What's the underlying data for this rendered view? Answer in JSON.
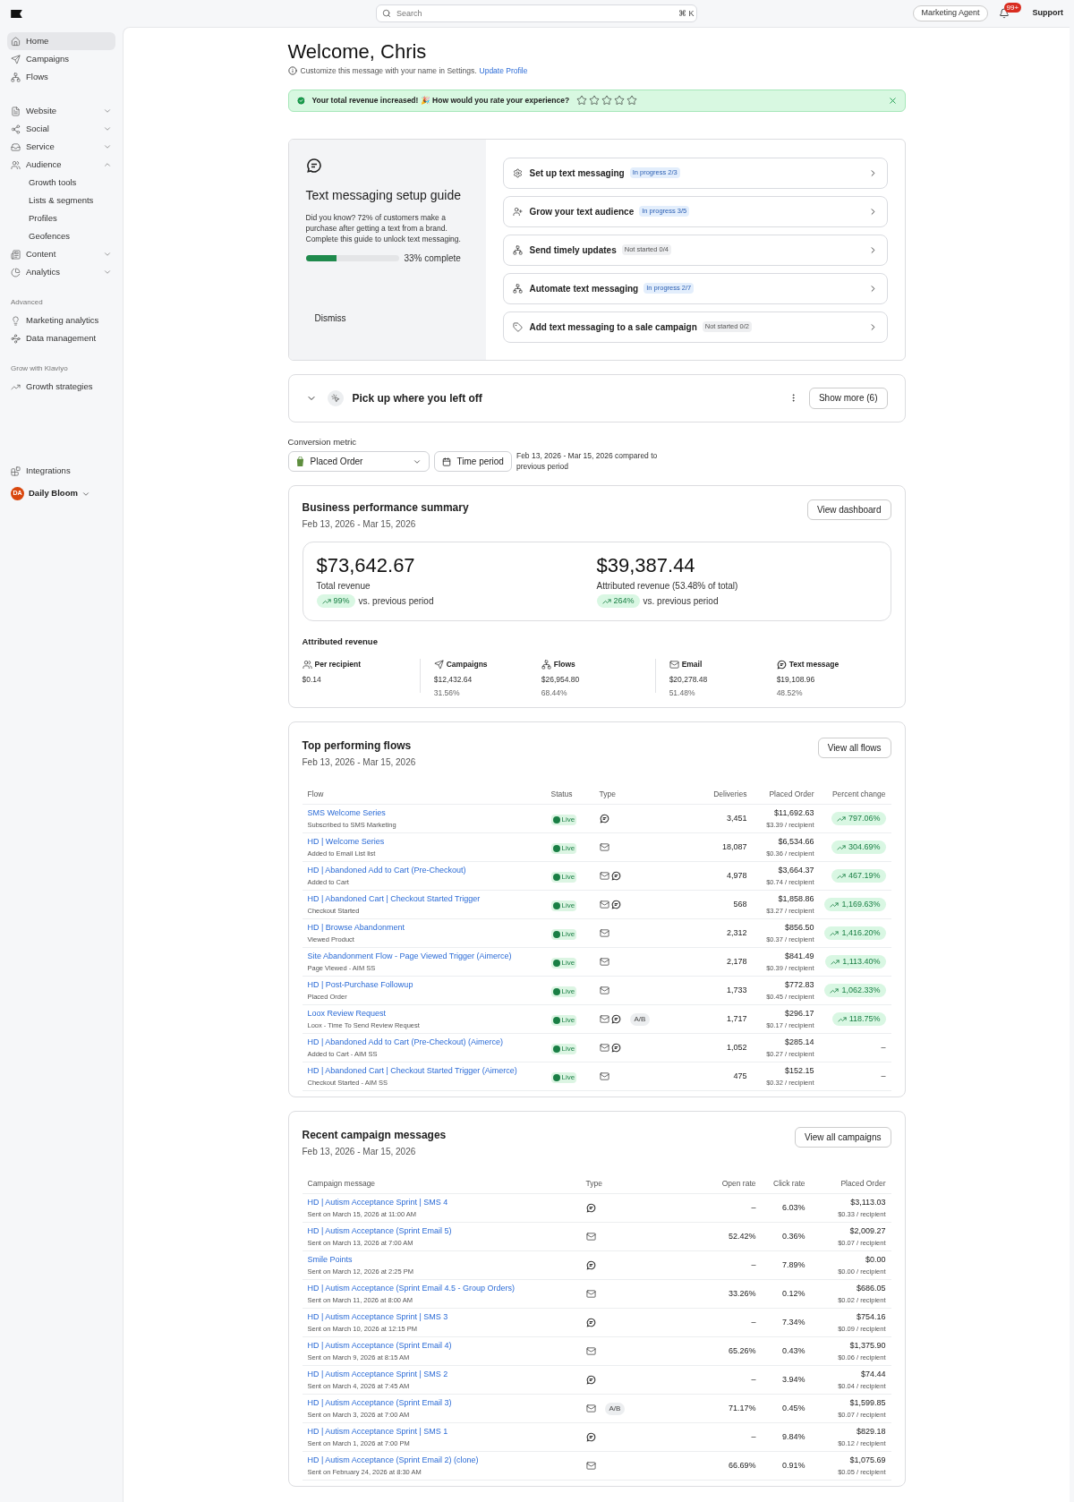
{
  "header": {
    "search": {
      "placeholder": "Search",
      "shortcut": "⌘ K"
    },
    "agent_button": "Marketing Agent",
    "notifications": "99+",
    "support": "Support"
  },
  "sidebar": {
    "groups": [
      {
        "items": [
          {
            "label": "Home",
            "selected": true
          },
          {
            "label": "Campaigns",
            "selected": false
          },
          {
            "label": "Flows",
            "selected": false
          }
        ]
      },
      {
        "items": [
          {
            "label": "Website",
            "selected": false,
            "expanded": false
          },
          {
            "label": "Social",
            "selected": false,
            "expanded": false
          },
          {
            "label": "Service",
            "selected": false,
            "expanded": false
          },
          {
            "label": "Audience",
            "selected": false,
            "expanded": true,
            "children": [
              {
                "label": "Growth tools",
                "selected": false
              },
              {
                "label": "Lists & segments",
                "selected": false
              },
              {
                "label": "Profiles",
                "selected": false
              },
              {
                "label": "Geofences",
                "selected": false
              }
            ]
          },
          {
            "label": "Content",
            "selected": false,
            "expanded": false
          },
          {
            "label": "Analytics",
            "selected": false,
            "expanded": false
          }
        ]
      },
      {
        "heading": "Advanced",
        "items": [
          {
            "label": "Marketing analytics",
            "selected": false
          },
          {
            "label": "Data management",
            "selected": false
          }
        ]
      },
      {
        "heading": "Grow with Klaviyo",
        "items": [
          {
            "label": "Growth strategies",
            "selected": false
          }
        ]
      }
    ],
    "footer_items": [
      {
        "label": "Integrations",
        "selected": false
      }
    ],
    "account": {
      "initials": "DA",
      "name": "Daily Bloom"
    }
  },
  "welcome": {
    "title": "Welcome, Chris",
    "hint": "Customize this message with your name in Settings.",
    "link": "Update Profile"
  },
  "banner": {
    "text": "Your total revenue increased! 🎉 How would you rate your experience?",
    "stars": 0
  },
  "setup_guide": {
    "title": "Text messaging setup guide",
    "description": "Did you know? 72% of customers make a purchase after getting a text from a brand. Complete this guide to unlock text messaging.",
    "level": 0.33,
    "progress_text": "33% complete",
    "dismiss": "Dismiss",
    "steps": [
      {
        "label": "Set up text messaging",
        "status": "In progress 2/3",
        "kind": "in_progress"
      },
      {
        "label": "Grow your text audience",
        "status": "In progress 3/5",
        "kind": "in_progress"
      },
      {
        "label": "Send timely updates",
        "status": "Not started 0/4",
        "kind": "not_started"
      },
      {
        "label": "Automate text messaging",
        "status": "In progress 2/7",
        "kind": "in_progress"
      },
      {
        "label": "Add text messaging to a sale campaign",
        "status": "Not started 0/2",
        "kind": "not_started"
      }
    ]
  },
  "pickup": {
    "title": "Pick up where you left off",
    "expanded": false,
    "button": "Show more (6)"
  },
  "conversion": {
    "label": "Conversion metric",
    "metric": "Placed Order",
    "time_button": "Time period",
    "range": "Feb 13, 2026 - Mar 15, 2026 compared to previous period"
  },
  "summary": {
    "title": "Business performance summary",
    "dates": "Feb 13, 2026 - Mar 15, 2026",
    "button": "View dashboard",
    "stats": [
      {
        "value": "$73,642.67",
        "label": "Total revenue",
        "change": "99%",
        "suffix": "vs. previous period"
      },
      {
        "value": "$39,387.44",
        "label": "Attributed revenue (53.48% of total)",
        "change": "264%",
        "suffix": "vs. previous period"
      }
    ],
    "attributed_title": "Attributed revenue",
    "groups": [
      [
        {
          "label": "Per recipient",
          "value": "$0.14"
        }
      ],
      [
        {
          "label": "Campaigns",
          "value": "$12,432.64",
          "share": "31.56%"
        },
        {
          "label": "Flows",
          "value": "$26,954.80",
          "share": "68.44%"
        }
      ],
      [
        {
          "label": "Email",
          "value": "$20,278.48",
          "share": "51.48%"
        },
        {
          "label": "Text message",
          "value": "$19,108.96",
          "share": "48.52%"
        }
      ]
    ]
  },
  "flows": {
    "title": "Top performing flows",
    "dates": "Feb 13, 2026 - Mar 15, 2026",
    "button": "View all flows",
    "columns": [
      "Flow",
      "Status",
      "Type",
      "Deliveries",
      "Placed Order",
      "Percent change"
    ],
    "rows": [
      {
        "name": "SMS Welcome Series",
        "trigger": "Subscribed to SMS Marketing",
        "status": "Live",
        "types": [
          {
            "kind": "sms"
          }
        ],
        "deliveries": "3,451",
        "placed_order": "$11,692.63",
        "per_recipient": "$3.39 / recipient",
        "change": "797.06%",
        "trending": true
      },
      {
        "name": "HD | Welcome Series",
        "trigger": "Added to Email List list",
        "status": "Live",
        "types": [
          {
            "kind": "email"
          }
        ],
        "deliveries": "18,087",
        "placed_order": "$6,534.66",
        "per_recipient": "$0.36 / recipient",
        "change": "304.69%",
        "trending": true
      },
      {
        "name": "HD | Abandoned Add to Cart (Pre-Checkout)",
        "trigger": "Added to Cart",
        "status": "Live",
        "types": [
          {
            "kind": "email"
          },
          {
            "kind": "sms"
          }
        ],
        "deliveries": "4,978",
        "placed_order": "$3,664.37",
        "per_recipient": "$0.74 / recipient",
        "change": "467.19%",
        "trending": true
      },
      {
        "name": "HD | Abandoned Cart | Checkout Started Trigger",
        "trigger": "Checkout Started",
        "status": "Live",
        "types": [
          {
            "kind": "email"
          },
          {
            "kind": "sms"
          }
        ],
        "deliveries": "568",
        "placed_order": "$1,858.86",
        "per_recipient": "$3.27 / recipient",
        "change": "1,169.63%",
        "trending": true
      },
      {
        "name": "HD | Browse Abandonment",
        "trigger": "Viewed Product",
        "status": "Live",
        "types": [
          {
            "kind": "email"
          }
        ],
        "deliveries": "2,312",
        "placed_order": "$856.50",
        "per_recipient": "$0.37 / recipient",
        "change": "1,416.20%",
        "trending": true
      },
      {
        "name": "Site Abandonment Flow - Page Viewed Trigger (Aimerce)",
        "trigger": "Page Viewed - AIM SS",
        "status": "Live",
        "types": [
          {
            "kind": "email"
          }
        ],
        "deliveries": "2,178",
        "placed_order": "$841.49",
        "per_recipient": "$0.39 / recipient",
        "change": "1,113.40%",
        "trending": true
      },
      {
        "name": "HD | Post-Purchase Followup",
        "trigger": "Placed Order",
        "status": "Live",
        "types": [
          {
            "kind": "email"
          }
        ],
        "deliveries": "1,733",
        "placed_order": "$772.83",
        "per_recipient": "$0.45 / recipient",
        "change": "1,062.33%",
        "trending": true
      },
      {
        "name": "Loox Review Request",
        "trigger": "Loox - Time To Send Review Request",
        "status": "Live",
        "types": [
          {
            "kind": "email"
          },
          {
            "kind": "sms"
          }
        ],
        "ab": "A/B",
        "deliveries": "1,717",
        "placed_order": "$296.17",
        "per_recipient": "$0.17 / recipient",
        "change": "118.75%",
        "trending": true
      },
      {
        "name": "HD | Abandoned Add to Cart (Pre-Checkout) (Aimerce)",
        "trigger": "Added to Cart - AIM SS",
        "status": "Live",
        "types": [
          {
            "kind": "email"
          },
          {
            "kind": "sms"
          }
        ],
        "deliveries": "1,052",
        "placed_order": "$285.14",
        "per_recipient": "$0.27 / recipient",
        "change": "–",
        "trending": false
      },
      {
        "name": "HD | Abandoned Cart | Checkout Started Trigger (Aimerce)",
        "trigger": "Checkout Started - AIM SS",
        "status": "Live",
        "types": [
          {
            "kind": "email"
          }
        ],
        "deliveries": "475",
        "placed_order": "$152.15",
        "per_recipient": "$0.32 / recipient",
        "change": "–",
        "trending": false
      }
    ]
  },
  "campaigns": {
    "title": "Recent campaign messages",
    "dates": "Feb 13, 2026 - Mar 15, 2026",
    "button": "View all campaigns",
    "columns": [
      "Campaign message",
      "Type",
      "Open rate",
      "Click rate",
      "Placed Order"
    ],
    "rows": [
      {
        "name": "HD | Autism Acceptance Sprint | SMS 4",
        "sent": "Sent on March 15, 2026 at 11:00 AM",
        "kind": "sms",
        "open_rate": "–",
        "click_rate": "6.03%",
        "placed_order": "$3,113.03",
        "per_recipient": "$0.33 / recipient"
      },
      {
        "name": "HD | Autism Acceptance (Sprint Email 5)",
        "sent": "Sent on March 13, 2026 at 7:00 AM",
        "kind": "email",
        "open_rate": "52.42%",
        "click_rate": "0.36%",
        "placed_order": "$2,009.27",
        "per_recipient": "$0.07 / recipient"
      },
      {
        "name": "Smile Points",
        "sent": "Sent on March 12, 2026 at 2:25 PM",
        "kind": "sms",
        "open_rate": "–",
        "click_rate": "7.89%",
        "placed_order": "$0.00",
        "per_recipient": "$0.00 / recipient"
      },
      {
        "name": "HD | Autism Acceptance (Sprint Email 4.5 - Group Orders)",
        "sent": "Sent on March 11, 2026 at 8:00 AM",
        "kind": "email",
        "open_rate": "33.26%",
        "click_rate": "0.12%",
        "placed_order": "$686.05",
        "per_recipient": "$0.02 / recipient"
      },
      {
        "name": "HD | Autism Acceptance Sprint | SMS 3",
        "sent": "Sent on March 10, 2026 at 12:15 PM",
        "kind": "sms",
        "open_rate": "–",
        "click_rate": "7.34%",
        "placed_order": "$754.16",
        "per_recipient": "$0.09 / recipient"
      },
      {
        "name": "HD | Autism Acceptance (Sprint Email 4)",
        "sent": "Sent on March 9, 2026 at 8:15 AM",
        "kind": "email",
        "open_rate": "65.26%",
        "click_rate": "0.43%",
        "placed_order": "$1,375.90",
        "per_recipient": "$0.06 / recipient"
      },
      {
        "name": "HD | Autism Acceptance Sprint | SMS 2",
        "sent": "Sent on March 4, 2026 at 7:45 AM",
        "kind": "sms",
        "open_rate": "–",
        "click_rate": "3.94%",
        "placed_order": "$74.44",
        "per_recipient": "$0.04 / recipient"
      },
      {
        "name": "HD | Autism Acceptance (Sprint Email 3)",
        "sent": "Sent on March 3, 2026 at 7:00 AM",
        "kind": "email",
        "ab": "A/B",
        "open_rate": "71.17%",
        "click_rate": "0.45%",
        "placed_order": "$1,599.85",
        "per_recipient": "$0.07 / recipient"
      },
      {
        "name": "HD | Autism Acceptance Sprint | SMS 1",
        "sent": "Sent on March 1, 2026 at 7:00 PM",
        "kind": "sms",
        "open_rate": "–",
        "click_rate": "9.84%",
        "placed_order": "$829.18",
        "per_recipient": "$0.12 / recipient"
      },
      {
        "name": "HD | Autism Acceptance (Sprint Email 2) (clone)",
        "sent": "Sent on February 24, 2026 at 8:30 AM",
        "kind": "email",
        "open_rate": "66.69%",
        "click_rate": "0.91%",
        "placed_order": "$1,075.69",
        "per_recipient": "$0.05 / recipient"
      }
    ]
  }
}
